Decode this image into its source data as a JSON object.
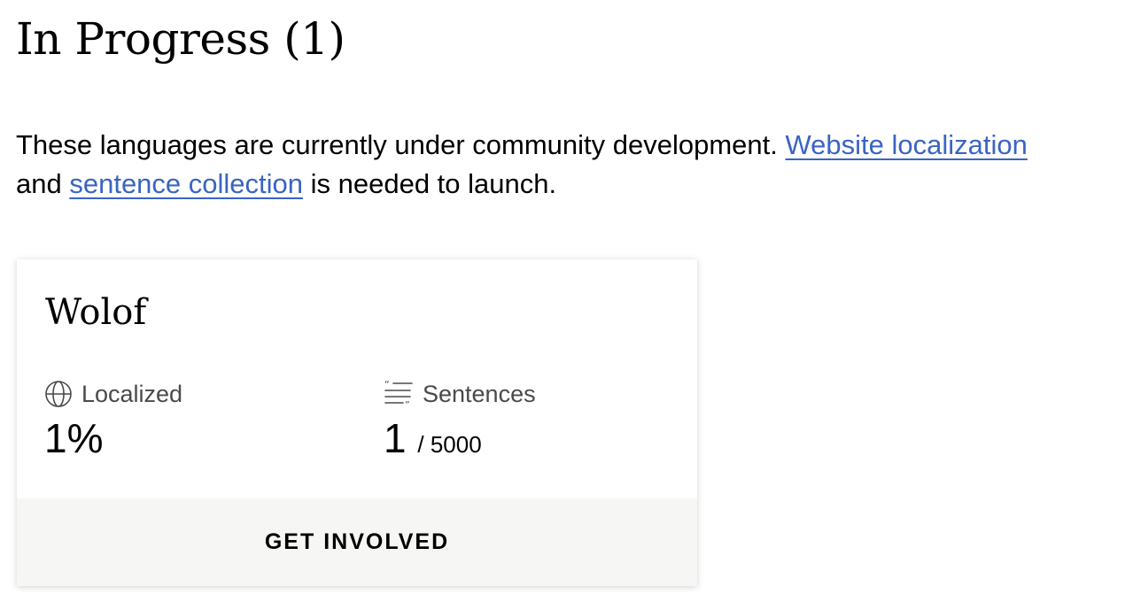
{
  "section": {
    "heading": "In Progress (1)",
    "intro_text_1": "These languages are currently under community development. ",
    "link_localization": "Website localization",
    "intro_text_2": " and ",
    "link_sentence_collection": "sentence collection",
    "intro_text_3": " is needed to launch."
  },
  "card": {
    "language": "Wolof",
    "localized_label": "Localized",
    "localized_value": "1%",
    "sentences_label": "Sentences",
    "sentences_value": "1",
    "sentences_total": "/ 5000",
    "cta": "GET INVOLVED"
  },
  "colors": {
    "link": "#3a64c3",
    "footer_bg": "#f6f6f5"
  },
  "icons": {
    "localized": "globe-icon",
    "sentences": "quote-lines-icon"
  }
}
